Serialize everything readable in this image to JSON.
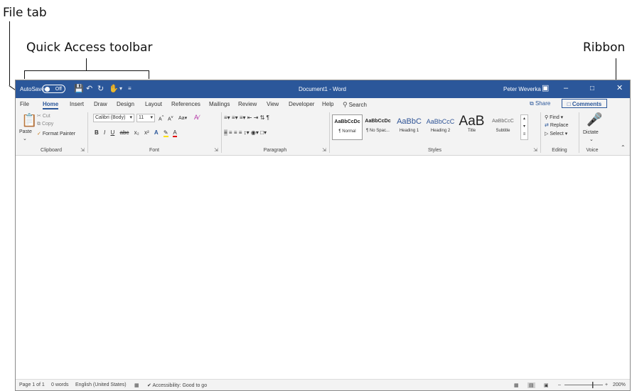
{
  "annotations": {
    "file_tab": "File tab",
    "quick_access": "Quick Access toolbar",
    "ribbon": "Ribbon"
  },
  "titlebar": {
    "autosave": "AutoSave",
    "autosave_state": "Off",
    "doc_title": "Document1  -  Word",
    "user": "Peter Weverka",
    "colors": {
      "bar": "#2b579a"
    },
    "icons": [
      "save-icon",
      "undo-icon",
      "redo-icon",
      "customize-qat-icon",
      "ribbon-display-icon",
      "minimize-icon",
      "maximize-icon",
      "close-icon"
    ]
  },
  "tabs": [
    "File",
    "Home",
    "Insert",
    "Draw",
    "Design",
    "Layout",
    "References",
    "Mailings",
    "Review",
    "View",
    "Developer",
    "Help"
  ],
  "search": "Search",
  "share": "Share",
  "comments": "Comments",
  "clipboard": {
    "paste": "Paste",
    "cut": "Cut",
    "copy": "Copy",
    "format_painter": "Format Painter",
    "label": "Clipboard"
  },
  "font": {
    "name": "Calibri (Body)",
    "size": "11",
    "change_case": "Aa",
    "label": "Font",
    "buttons": [
      "B",
      "I",
      "U",
      "abc",
      "x₂",
      "x²"
    ]
  },
  "paragraph": {
    "label": "Paragraph"
  },
  "styles": {
    "items": [
      {
        "sample": "AaBbCcDc",
        "name": "¶ Normal"
      },
      {
        "sample": "AaBbCcDc",
        "name": "¶ No Spac..."
      },
      {
        "sample": "AaBbC",
        "name": "Heading 1"
      },
      {
        "sample": "AaBbCcC",
        "name": "Heading 2"
      },
      {
        "sample": "AaB",
        "name": "Title"
      },
      {
        "sample": "AaBbCcC",
        "name": "Subtitle"
      }
    ],
    "label": "Styles"
  },
  "editing": {
    "find": "Find",
    "replace": "Replace",
    "select": "Select",
    "label": "Editing"
  },
  "voice": {
    "dictate": "Dictate",
    "label": "Voice"
  },
  "status": {
    "page": "Page 1 of 1",
    "words": "0 words",
    "language": "English (United States)",
    "accessibility": "Accessibility: Good to go",
    "zoom": "200%"
  }
}
